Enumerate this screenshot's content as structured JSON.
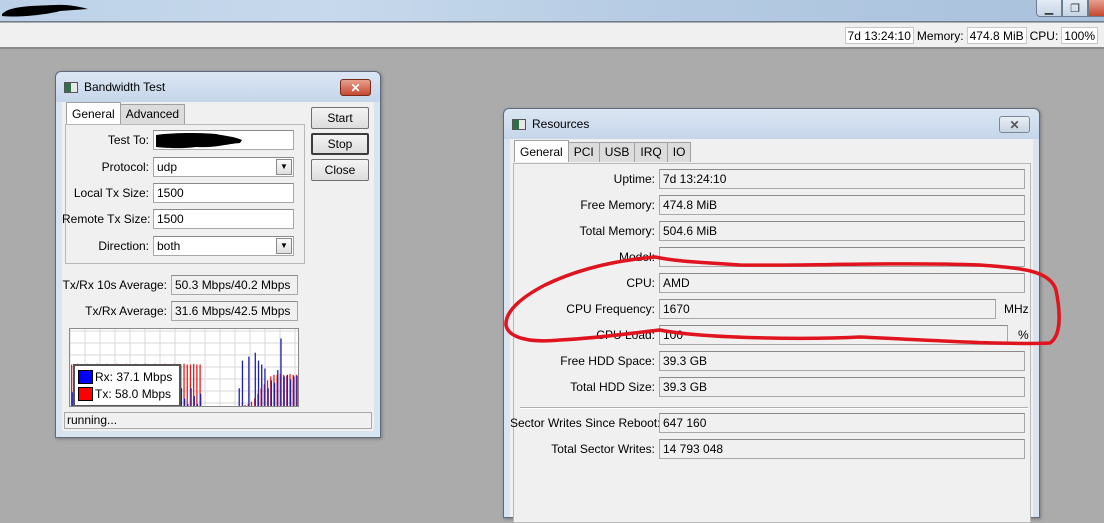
{
  "app": {
    "title_redacted": true,
    "window_controls": {
      "minimize": "minimize",
      "restore": "restore",
      "close": "close"
    }
  },
  "toolbar": {
    "uptime": "7d 13:24:10",
    "memory_label": "Memory:",
    "memory_value": "474.8 MiB",
    "cpu_label": "CPU:",
    "cpu_value": "100%"
  },
  "bandwidth_test": {
    "title": "Bandwidth Test",
    "tabs": [
      {
        "label": "General",
        "active": true
      },
      {
        "label": "Advanced",
        "active": false
      }
    ],
    "fields": {
      "test_to": {
        "label": "Test To:",
        "value": "",
        "redacted": true
      },
      "protocol": {
        "label": "Protocol:",
        "value": "udp"
      },
      "local_tx_size": {
        "label": "Local Tx Size:",
        "value": "1500"
      },
      "remote_tx_size": {
        "label": "Remote Tx Size:",
        "value": "1500"
      },
      "direction": {
        "label": "Direction:",
        "value": "both"
      }
    },
    "buttons": {
      "start": "Start",
      "stop": "Stop",
      "close": "Close"
    },
    "averages": {
      "tx_rx_10s": {
        "label": "Tx/Rx 10s Average:",
        "value": "50.3 Mbps/40.2 Mbps"
      },
      "tx_rx": {
        "label": "Tx/Rx Average:",
        "value": "31.6 Mbps/42.5 Mbps"
      }
    },
    "graph": {
      "legend": [
        {
          "label": "Rx: 37.1 Mbps",
          "color": "#0000ff"
        },
        {
          "label": "Tx: 58.0 Mbps",
          "color": "#ff0000"
        }
      ],
      "tx_bars": [
        0.55,
        0.55,
        0.56,
        0.55,
        0.55,
        0.56,
        0.55,
        0.55,
        0.56,
        0.55,
        0.55,
        0.56,
        0.55,
        0.55,
        0.56,
        0.55,
        0.55,
        0.56,
        0.55,
        0.55,
        0.56,
        0.55,
        0.55,
        0.56,
        0.55,
        0.55,
        0.56,
        0.55,
        0.55,
        0.56,
        0.55,
        0.55,
        0.56,
        0.55,
        0.55,
        0.56,
        0.55,
        0.55,
        0.56,
        0.55,
        0.55,
        0,
        0,
        0,
        0,
        0,
        0,
        0,
        0,
        0,
        0,
        0,
        0.02,
        0.03,
        0.04,
        0.05,
        0.08,
        0.12,
        0.18,
        0.25,
        0.3,
        0.35,
        0.4,
        0.42,
        0.42,
        0.43,
        0.42,
        0.41,
        0.43,
        0.42,
        0.42
      ],
      "rx_bars": [
        0.2,
        0.02,
        0.02,
        0.02,
        0.02,
        0.02,
        0.02,
        0.02,
        0.02,
        0.02,
        0.02,
        0.02,
        0.02,
        0.02,
        0.02,
        0.02,
        0.02,
        0.02,
        0.02,
        0.02,
        0.02,
        0.02,
        0.02,
        0.02,
        0.02,
        0.02,
        0.02,
        0.02,
        0.02,
        0.02,
        0.02,
        0.02,
        0.02,
        0.12,
        0.25,
        0.12,
        0.05,
        0.25,
        0.15,
        0.05,
        0.18,
        0,
        0,
        0,
        0,
        0,
        0,
        0,
        0,
        0,
        0,
        0,
        0.25,
        0.6,
        0.02,
        0.65,
        0.02,
        0.7,
        0.6,
        0.55,
        0.5,
        0.25,
        0.35,
        0.32,
        0.48,
        0.88,
        0.4,
        0.42,
        0.36,
        0.4,
        0.41
      ],
      "status": "running..."
    }
  },
  "resources": {
    "title": "Resources",
    "tabs": [
      {
        "label": "General",
        "active": true
      },
      {
        "label": "PCI",
        "active": false
      },
      {
        "label": "USB",
        "active": false
      },
      {
        "label": "IRQ",
        "active": false
      },
      {
        "label": "IO",
        "active": false
      }
    ],
    "rows": [
      {
        "label": "Uptime:",
        "value": "7d 13:24:10",
        "unit": ""
      },
      {
        "label": "Free Memory:",
        "value": "474.8 MiB",
        "unit": ""
      },
      {
        "label": "Total Memory:",
        "value": "504.6 MiB",
        "unit": ""
      },
      {
        "label": "Model:",
        "value": "",
        "unit": ""
      },
      {
        "label": "CPU:",
        "value": "AMD",
        "unit": ""
      },
      {
        "label": "CPU Frequency:",
        "value": "1670",
        "unit": "MHz"
      },
      {
        "label": "CPU Load:",
        "value": "100",
        "unit": "%"
      },
      {
        "label": "Free HDD Space:",
        "value": "39.3 GB",
        "unit": ""
      },
      {
        "label": "Total HDD Size:",
        "value": "39.3 GB",
        "unit": ""
      }
    ],
    "rows2": [
      {
        "label": "Sector Writes Since Reboot:",
        "value": "647 160"
      },
      {
        "label": "Total Sector Writes:",
        "value": "14 793 048"
      }
    ]
  },
  "annotation": {
    "color": "#e0141e",
    "shape": "hand-drawn-circle",
    "encloses": "CPU, CPU Frequency, CPU Load"
  }
}
